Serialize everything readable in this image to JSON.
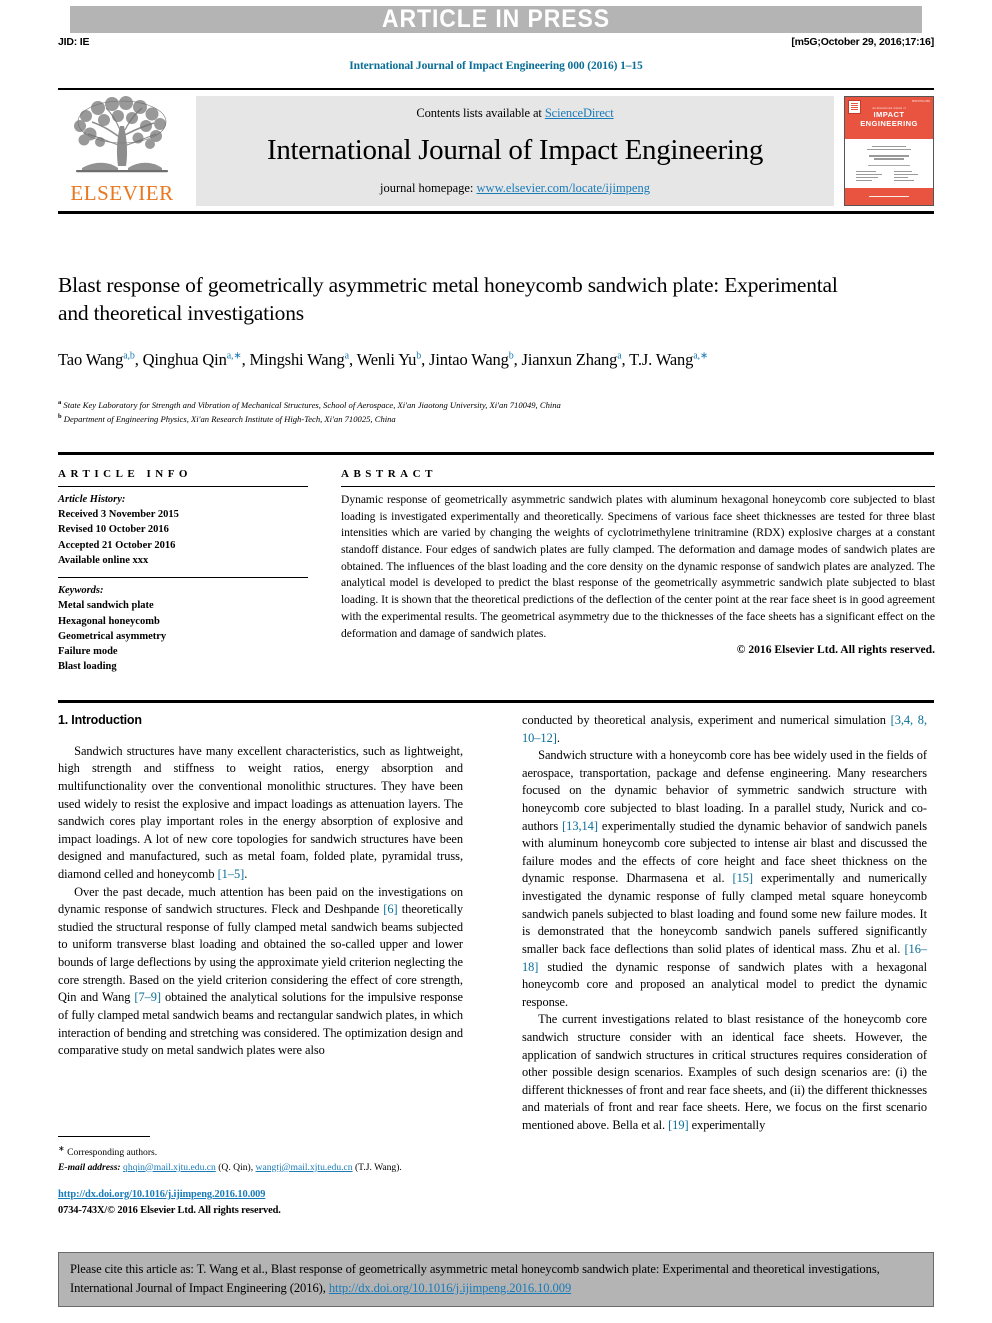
{
  "banner": {
    "article_in_press": "ARTICLE IN PRESS",
    "jid": "JID: IE",
    "timestamp": "[m5G;October 29, 2016;17:16]"
  },
  "journal_ref": "International Journal of Impact Engineering 000 (2016) 1–15",
  "masthead": {
    "publisher_logo_text": "ELSEVIER",
    "contents_prefix": "Contents lists available at ",
    "contents_link": "ScienceDirect",
    "journal_title": "International Journal of Impact Engineering",
    "homepage_prefix": "journal homepage: ",
    "homepage_link": "www.elsevier.com/locate/ijimpeng",
    "cover": {
      "issn": "ISSN 0734-743X",
      "small_top": "An International Journal of",
      "name_line1": "IMPACT",
      "name_line2": "ENGINEERING"
    }
  },
  "article": {
    "title": "Blast response of geometrically asymmetric metal honeycomb sandwich plate: Experimental and theoretical investigations",
    "authors_html": "Tao Wang<sup>a,b</sup>, Qinghua Qin<sup>a,∗</sup>, Mingshi Wang<sup>a</sup>, Wenli Yu<sup>b</sup>, Jintao Wang<sup>b</sup>, Jianxun Zhang<sup>a</sup>, T.J. Wang<sup>a,∗</sup>",
    "affiliation_a": "State Key Laboratory for Strength and Vibration of Mechanical Structures, School of Aerospace, Xi'an Jiaotong University, Xi'an 710049, China",
    "affiliation_b": "Department of Engineering Physics, Xi'an Research Institute of High-Tech, Xi'an 710025, China"
  },
  "info": {
    "heading": "ARTICLE INFO",
    "history_label": "Article History:",
    "history": [
      "Received 3 November 2015",
      "Revised 10 October 2016",
      "Accepted 21 October 2016",
      "Available online xxx"
    ],
    "keywords_label": "Keywords:",
    "keywords": [
      "Metal sandwich plate",
      "Hexagonal honeycomb",
      "Geometrical asymmetry",
      "Failure mode",
      "Blast loading"
    ]
  },
  "abstract": {
    "heading": "ABSTRACT",
    "body": "Dynamic response of geometrically asymmetric sandwich plates with aluminum hexagonal honeycomb core subjected to blast loading is investigated experimentally and theoretically. Specimens of various face sheet thicknesses are tested for three blast intensities which are varied by changing the weights of cyclotrimethylene trinitramine (RDX) explosive charges at a constant standoff distance. Four edges of sandwich plates are fully clamped. The deformation and damage modes of sandwich plates are obtained. The influences of the blast loading and the core density on the dynamic response of sandwich plates are analyzed. The analytical model is developed to predict the blast response of the geometrically asymmetric sandwich plate subjected to blast loading. It is shown that the theoretical predictions of the deflection of the center point at the rear face sheet is in good agreement with the experimental results. The geometrical asymmetry due to the thicknesses of the face sheets has a significant effect on the deformation and damage of sandwich plates.",
    "copyright": "© 2016 Elsevier Ltd. All rights reserved."
  },
  "body": {
    "section_title": "1. Introduction",
    "left_paragraphs": [
      "Sandwich structures have many excellent characteristics, such as lightweight, high strength and stiffness to weight ratios, energy absorption and multifunctionality over the conventional monolithic structures. They have been used widely to resist the explosive and impact loadings as attenuation layers. The sandwich cores play important roles in the energy absorption of explosive and impact loadings. A lot of new core topologies for sandwich structures have been designed and manufactured, such as metal foam, folded plate, pyramidal truss, diamond celled and honeycomb [1–5].",
      "Over the past decade, much attention has been paid on the investigations on dynamic response of sandwich structures. Fleck and Deshpande [6] theoretically studied the structural response of fully clamped metal sandwich beams subjected to uniform transverse blast loading and obtained the so-called upper and lower bounds of large deflections by using the approximate yield criterion neglecting the core strength. Based on the yield criterion considering the effect of core strength, Qin and Wang [7–9] obtained the analytical solutions for the impulsive response of fully clamped metal sandwich beams and rectangular sandwich plates, in which interaction of bending and stretching was considered. The optimization design and comparative study on metal sandwich plates were also"
    ],
    "right_paragraphs": [
      "conducted by theoretical analysis, experiment and numerical simulation [3,4, 8, 10–12].",
      "Sandwich structure with a honeycomb core has bee widely used in the fields of aerospace, transportation, package and defense engineering. Many researchers focused on the dynamic behavior of symmetric sandwich structure with honeycomb core subjected to blast loading. In a parallel study, Nurick and co-authors [13,14] experimentally studied the dynamic behavior of sandwich panels with aluminum honeycomb core subjected to intense air blast and discussed the failure modes and the effects of core height and face sheet thickness on the dynamic response. Dharmasena et al. [15] experimentally and numerically investigated the dynamic response of fully clamped metal square honeycomb sandwich panels subjected to blast loading and found some new failure modes. It is demonstrated that the honeycomb sandwich panels suffered significantly smaller back face deflections than solid plates of identical mass. Zhu et al. [16–18] studied the dynamic response of sandwich plates with a hexagonal honeycomb core and proposed an analytical model to predict the dynamic response.",
      "The current investigations related to blast resistance of the honeycomb core sandwich structure consider with an identical face sheets. However, the application of sandwich structures in critical structures requires consideration of other possible design scenarios. Examples of such design scenarios are: (i) the different thicknesses of front and rear face sheets, and (ii) the different thicknesses and materials of front and rear face sheets. Here, we focus on the first scenario mentioned above. Bella et al. [19] experimentally"
    ]
  },
  "footnote": {
    "corresponding": "Corresponding authors.",
    "email_label": "E-mail address:",
    "email_1": "qhqin@mail.xjtu.edu.cn",
    "email_1_who": "(Q. Qin),",
    "email_2": "wangtj@mail.xjtu.edu.cn",
    "email_2_who": "(T.J. Wang).",
    "doi": "http://dx.doi.org/10.1016/j.ijimpeng.2016.10.009",
    "issn_copyright": "0734-743X/© 2016 Elsevier Ltd. All rights reserved."
  },
  "cite_box": {
    "text_before": "Please cite this article as: T. Wang et al., Blast response of geometrically asymmetric metal honeycomb sandwich plate: Experimental and theoretical investigations, International Journal of Impact Engineering (2016), ",
    "link": "http://dx.doi.org/10.1016/j.ijimpeng.2016.10.009"
  },
  "colors": {
    "banner_gray": "#b4b4b4",
    "link_blue": "#1a7bb9",
    "ref_blue": "#0a6e96",
    "elsevier_orange": "#e87722",
    "cover_orange": "#e8543f"
  }
}
